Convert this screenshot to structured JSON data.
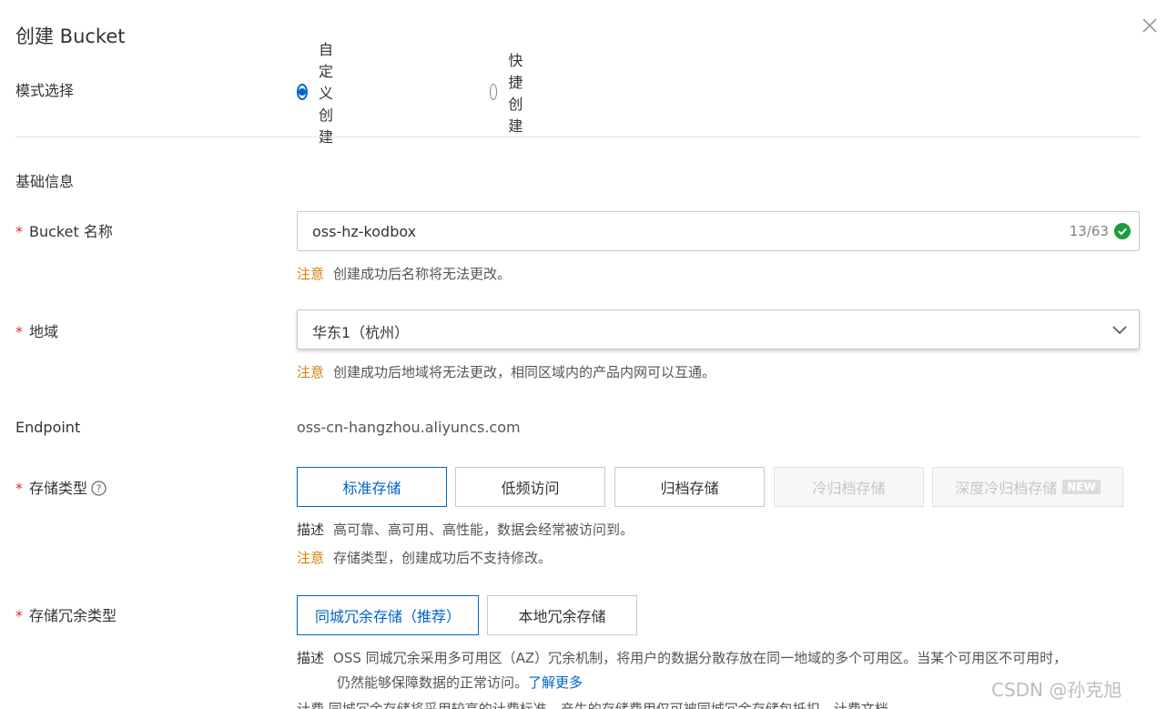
{
  "dialog": {
    "title": "创建 Bucket"
  },
  "mode": {
    "label": "模式选择",
    "options": [
      {
        "label": "自定义创建",
        "checked": true
      },
      {
        "label": "快捷创建",
        "checked": false
      }
    ]
  },
  "basic": {
    "section_title": "基础信息",
    "bucket_name": {
      "label": "Bucket 名称",
      "value": "oss-hz-kodbox",
      "counter": "13/63",
      "note_tag": "注意",
      "note_text": "创建成功后名称将无法更改。"
    },
    "region": {
      "label": "地域",
      "value": "华东1（杭州）",
      "note_tag": "注意",
      "note_text": "创建成功后地域将无法更改，相同区域内的产品内网可以互通。"
    },
    "endpoint": {
      "label": "Endpoint",
      "value": "oss-cn-hangzhou.aliyuncs.com"
    },
    "storage_class": {
      "label": "存储类型",
      "options": [
        {
          "label": "标准存储",
          "state": "selected"
        },
        {
          "label": "低频访问",
          "state": "normal"
        },
        {
          "label": "归档存储",
          "state": "normal"
        },
        {
          "label": "冷归档存储",
          "state": "disabled"
        },
        {
          "label": "深度冷归档存储",
          "state": "disabled",
          "badge": "NEW"
        }
      ],
      "desc_tag": "描述",
      "desc_text": "高可靠、高可用、高性能，数据会经常被访问到。",
      "note_tag": "注意",
      "note_text": "存储类型，创建成功后不支持修改。"
    },
    "redundancy": {
      "label": "存储冗余类型",
      "options": [
        {
          "label": "同城冗余存储（推荐）",
          "state": "selected"
        },
        {
          "label": "本地冗余存储",
          "state": "normal"
        }
      ],
      "desc_tag": "描述",
      "desc_line1": "OSS 同城冗余采用多可用区（AZ）冗余机制，将用户的数据分散存放在同一地域的多个可用区。当某个可用区不可用时，",
      "desc_line2": "仍然能够保障数据的正常访问。",
      "learn_more": "了解更多",
      "cutoff_text": "计费  同城冗余存储将采用较高的计费标准，产生的存储费用仅可被同城冗余存储包抵扣。计费文档"
    }
  },
  "watermark": "CSDN @孙克旭",
  "colors": {
    "primary": "#0064c8",
    "warning": "#d97c00",
    "required": "#d93026",
    "success": "#1a9e3b"
  }
}
